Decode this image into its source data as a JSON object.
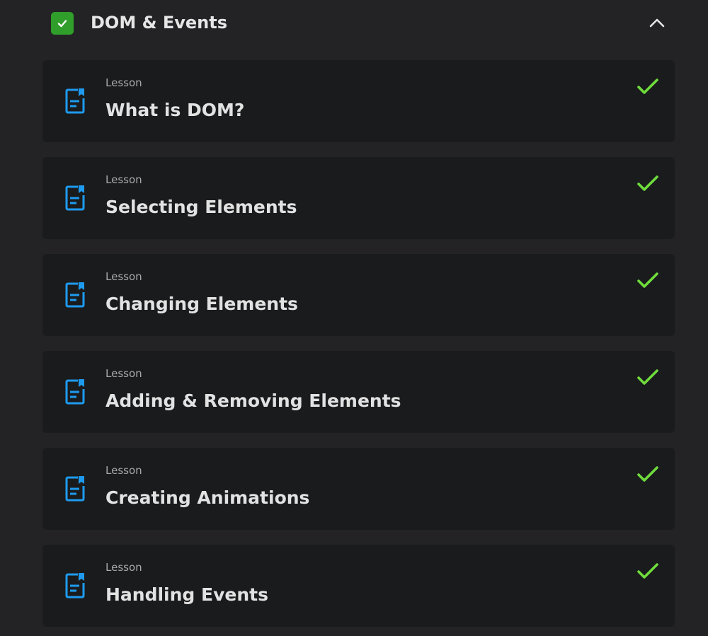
{
  "section": {
    "title": "DOM & Events",
    "completed": true,
    "expanded": true,
    "check_color": "#2f9e2a"
  },
  "lessons": [
    {
      "kicker": "Lesson",
      "title": "What is DOM?",
      "completed": true
    },
    {
      "kicker": "Lesson",
      "title": "Selecting Elements",
      "completed": true
    },
    {
      "kicker": "Lesson",
      "title": "Changing Elements",
      "completed": true
    },
    {
      "kicker": "Lesson",
      "title": "Adding & Removing Elements",
      "completed": true
    },
    {
      "kicker": "Lesson",
      "title": "Creating Animations",
      "completed": true
    },
    {
      "kicker": "Lesson",
      "title": "Handling Events",
      "completed": true
    }
  ],
  "icons": {
    "section_check": "checkbox-checked-icon",
    "collapse": "chevron-up-icon",
    "lesson": "document-bookmark-icon",
    "lesson_done": "checkmark-icon"
  },
  "colors": {
    "background": "#232325",
    "card": "#1a1b1d",
    "lesson_icon": "#1e9bef",
    "done_check": "#6fdc3c"
  }
}
